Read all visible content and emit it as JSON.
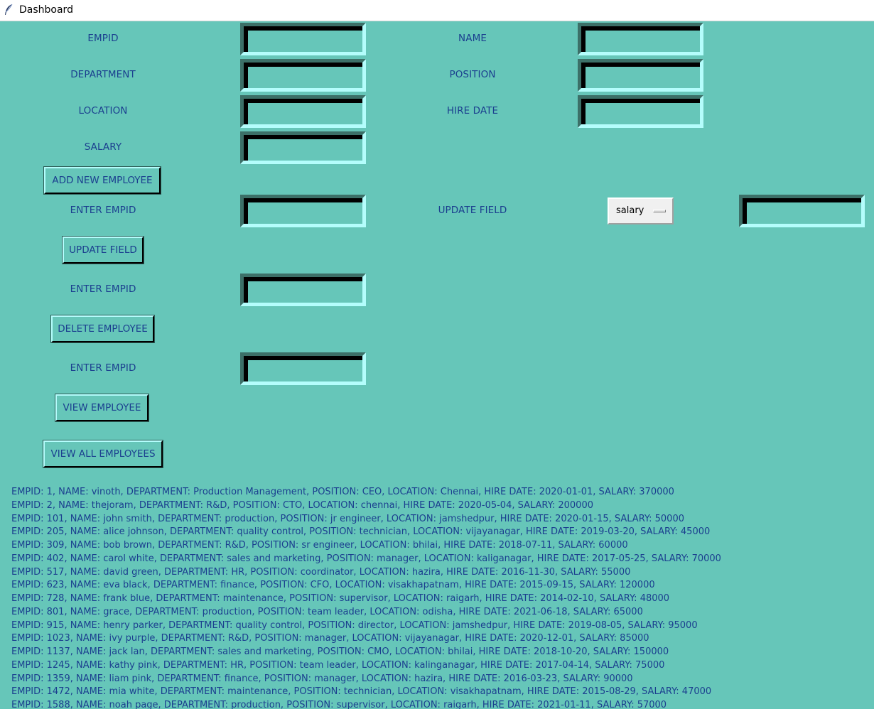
{
  "window": {
    "title": "Dashboard"
  },
  "form": {
    "empid_label": "EMPID",
    "name_label": "NAME",
    "department_label": "DEPARTMENT",
    "position_label": "POSITION",
    "location_label": "LOCATION",
    "hire_date_label": "HIRE DATE",
    "salary_label": "SALARY",
    "add_button": "ADD NEW EMPLOYEE"
  },
  "update": {
    "empid_label": "ENTER EMPID",
    "field_label": "UPDATE FIELD",
    "field_selected": "salary",
    "button": "UPDATE FIELD"
  },
  "delete": {
    "empid_label": "ENTER EMPID",
    "button": "DELETE EMPLOYEE"
  },
  "view": {
    "empid_label": "ENTER EMPID",
    "button": "VIEW EMPLOYEE",
    "all_button": "VIEW ALL EMPLOYEES"
  },
  "records": [
    "EMPID: 1, NAME: vinoth, DEPARTMENT: Production Management, POSITION: CEO, LOCATION: Chennai, HIRE DATE: 2020-01-01, SALARY: 370000",
    "EMPID: 2, NAME: thejoram, DEPARTMENT: R&D, POSITION: CTO, LOCATION: chennai, HIRE DATE: 2020-05-04, SALARY: 200000",
    "EMPID: 101, NAME: john smith, DEPARTMENT: production, POSITION: jr engineer, LOCATION: jamshedpur, HIRE DATE: 2020-01-15, SALARY: 50000",
    "EMPID: 205, NAME: alice johnson, DEPARTMENT: quality control, POSITION: technician, LOCATION: vijayanagar, HIRE DATE: 2019-03-20, SALARY: 45000",
    "EMPID: 309, NAME: bob brown, DEPARTMENT: R&D, POSITION: sr engineer, LOCATION: bhilai, HIRE DATE: 2018-07-11, SALARY: 60000",
    "EMPID: 402, NAME: carol white, DEPARTMENT: sales and marketing, POSITION: manager, LOCATION: kaliganagar, HIRE DATE: 2017-05-25, SALARY: 70000",
    "EMPID: 517, NAME: david green, DEPARTMENT: HR, POSITION: coordinator, LOCATION: hazira, HIRE DATE: 2016-11-30, SALARY: 55000",
    "EMPID: 623, NAME: eva black, DEPARTMENT: finance, POSITION: CFO, LOCATION: visakhapatnam, HIRE DATE: 2015-09-15, SALARY: 120000",
    "EMPID: 728, NAME: frank blue, DEPARTMENT: maintenance, POSITION: supervisor, LOCATION: raigarh, HIRE DATE: 2014-02-10, SALARY: 48000",
    "EMPID: 801, NAME: grace, DEPARTMENT: production, POSITION: team leader, LOCATION: odisha, HIRE DATE: 2021-06-18, SALARY: 65000",
    "EMPID: 915, NAME: henry parker, DEPARTMENT: quality control, POSITION: director, LOCATION: jamshedpur, HIRE DATE: 2019-08-05, SALARY: 95000",
    "EMPID: 1023, NAME: ivy purple, DEPARTMENT: R&D, POSITION: manager, LOCATION: vijayanagar, HIRE DATE: 2020-12-01, SALARY: 85000",
    "EMPID: 1137, NAME: jack lan, DEPARTMENT: sales and marketing, POSITION: CMO, LOCATION: bhilai, HIRE DATE: 2018-10-20, SALARY: 150000",
    "EMPID: 1245, NAME: kathy pink, DEPARTMENT: HR, POSITION: team leader, LOCATION: kalinganagar, HIRE DATE: 2017-04-14, SALARY: 75000",
    "EMPID: 1359, NAME: liam pink, DEPARTMENT: finance, POSITION: manager, LOCATION: hazira, HIRE DATE: 2016-03-23, SALARY: 90000",
    "EMPID: 1472, NAME: mia white, DEPARTMENT: maintenance, POSITION: technician, LOCATION: visakhapatnam, HIRE DATE: 2015-08-29, SALARY: 47000",
    "EMPID: 1588, NAME: noah page, DEPARTMENT: production, POSITION: supervisor, LOCATION: raigarh, HIRE DATE: 2021-01-11, SALARY: 57000"
  ]
}
